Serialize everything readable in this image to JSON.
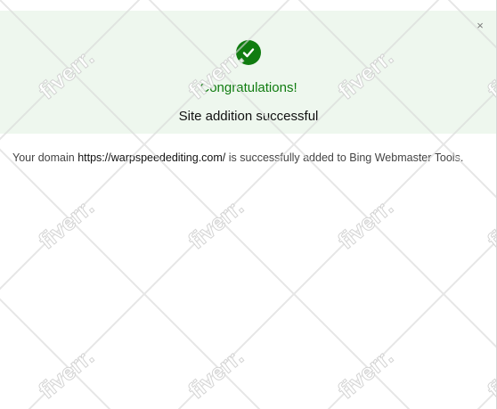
{
  "dialog": {
    "close_label": "×",
    "icon": "checkmark-icon",
    "title": "Congratulations!",
    "subtitle": "Site addition successful",
    "message_prefix": "Your domain ",
    "domain": "https://warpspeedediting.com/",
    "message_suffix": " is successfully added to Bing Webmaster Tools.",
    "colors": {
      "success_green": "#107c10",
      "hero_background": "#eef7ee",
      "body_text": "#444444"
    }
  },
  "watermark": {
    "text": "fiverr."
  }
}
